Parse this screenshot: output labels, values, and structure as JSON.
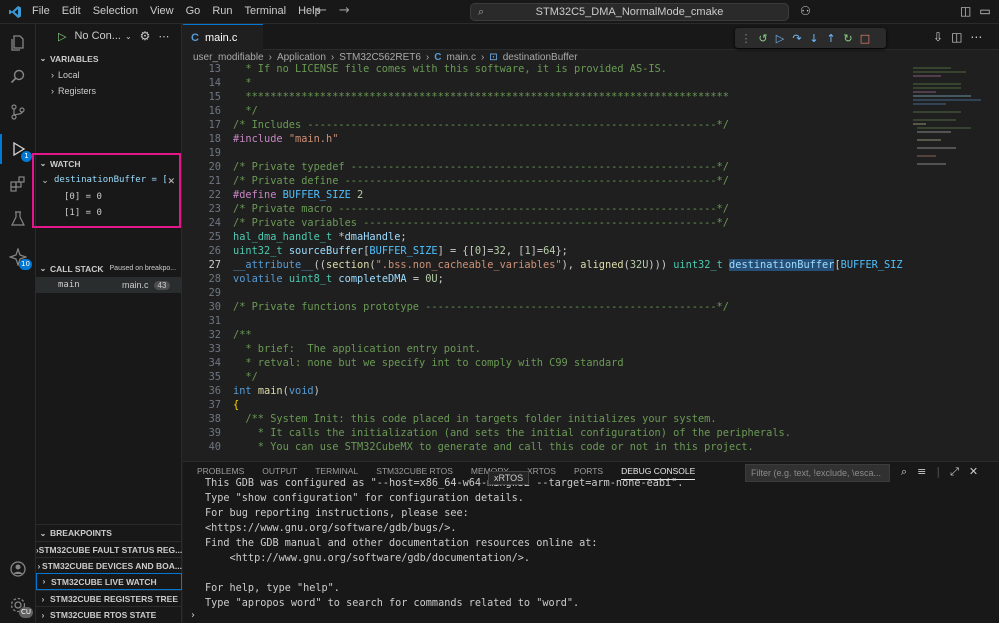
{
  "titlebar": {
    "menu": [
      "File",
      "Edit",
      "Selection",
      "View",
      "Go",
      "Run",
      "Terminal",
      "Help"
    ],
    "command_center": "STM32C5_DMA_NormalMode_cmake"
  },
  "activity_bar": {
    "debug_badge": "1",
    "stm32_badge": "10",
    "accounts_label": "CU"
  },
  "sidebar": {
    "run_config": "No Con...",
    "variables_header": "VARIABLES",
    "variables_items": [
      "Local",
      "Registers"
    ],
    "watch_header": "WATCH",
    "watch_expression": "destinationBuffer = [",
    "watch_children": [
      "[0] = 0",
      "[1] = 0"
    ],
    "call_stack_header": "CALL STACK",
    "call_stack_status": "Paused on breakpo...",
    "frame_name": "main",
    "frame_file": "main.c",
    "frame_line": "43",
    "breakpoints_header": "BREAKPOINTS",
    "sections": [
      "STM32CUBE FAULT STATUS REG...",
      "STM32CUBE DEVICES AND BOA...",
      "STM32CUBE LIVE WATCH",
      "STM32CUBE REGISTERS TREE",
      "STM32CUBE RTOS STATE"
    ]
  },
  "editor": {
    "tab_label": "main.c",
    "breadcrumbs": [
      "user_modifiable",
      "Application",
      "STM32C562RET6",
      "main.c",
      "destinationBuffer"
    ],
    "line_numbers": [
      "13",
      "14",
      "15",
      "16",
      "17",
      "18",
      "19",
      "20",
      "21",
      "22",
      "23",
      "24",
      "25",
      "26",
      "27",
      "28",
      "29",
      "30",
      "31",
      "32",
      "33",
      "34",
      "35",
      "36",
      "37",
      "38",
      "39",
      "40"
    ],
    "current_line": "27"
  },
  "panel": {
    "tabs": [
      "PROBLEMS",
      "OUTPUT",
      "TERMINAL",
      "STM32CUBE RTOS",
      "MEMORY",
      "XRTOS",
      "PORTS",
      "DEBUG CONSOLE"
    ],
    "active_tab": "DEBUG CONSOLE",
    "filter_placeholder": "Filter (e.g. text, !exclude, \\esca...",
    "tooltip": "xRTOS",
    "console_lines": [
      "This GDB was configured as \"--host=x86_64-w64-mingw32 --target=arm-none-eabi\".",
      "Type \"show configuration\" for configuration details.",
      "For bug reporting instructions, please see:",
      "<https://www.gnu.org/software/gdb/bugs/>.",
      "Find the GDB manual and other documentation resources online at:",
      "    <http://www.gnu.org/software/gdb/documentation/>.",
      "",
      "For help, type \"help\".",
      "Type \"apropos word\" to search for commands related to \"word\"."
    ]
  },
  "colors": {
    "accent": "#0078d4",
    "highlight_box": "#e3168c",
    "background": "#1f1f1f"
  }
}
